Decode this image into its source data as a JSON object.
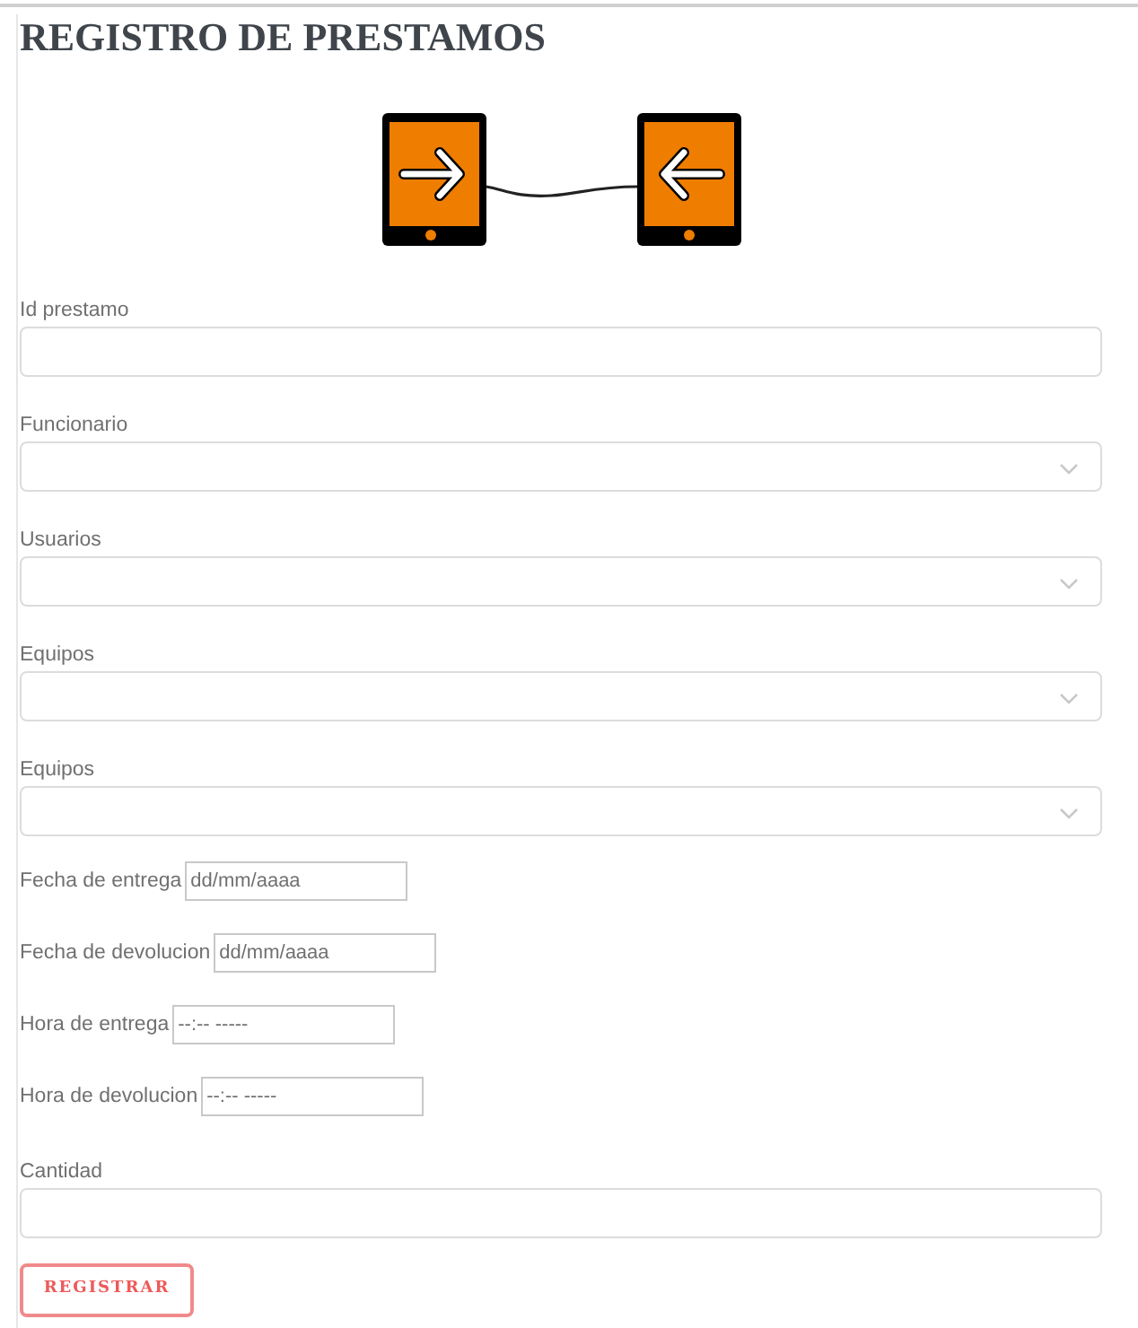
{
  "title": "REGISTRO DE PRESTAMOS",
  "fields": [
    {
      "kind": "text",
      "label": "Id prestamo"
    },
    {
      "kind": "select",
      "label": "Funcionario"
    },
    {
      "kind": "select",
      "label": "Usuarios"
    },
    {
      "kind": "select",
      "label": "Equipos"
    },
    {
      "kind": "select",
      "label": "Equipos"
    },
    {
      "kind": "inline",
      "label": "Fecha de entrega",
      "placeholder": "dd/mm/aaaa"
    },
    {
      "kind": "inline",
      "label": "Fecha de devolucion",
      "placeholder": "dd/mm/aaaa"
    },
    {
      "kind": "inline",
      "label": "Hora de entrega",
      "placeholder": "--:-- -----"
    },
    {
      "kind": "inline",
      "label": "Hora de devolucion",
      "placeholder": "--:-- -----"
    },
    {
      "kind": "text",
      "label": "Cantidad"
    }
  ],
  "submit": "REGISTRAR"
}
